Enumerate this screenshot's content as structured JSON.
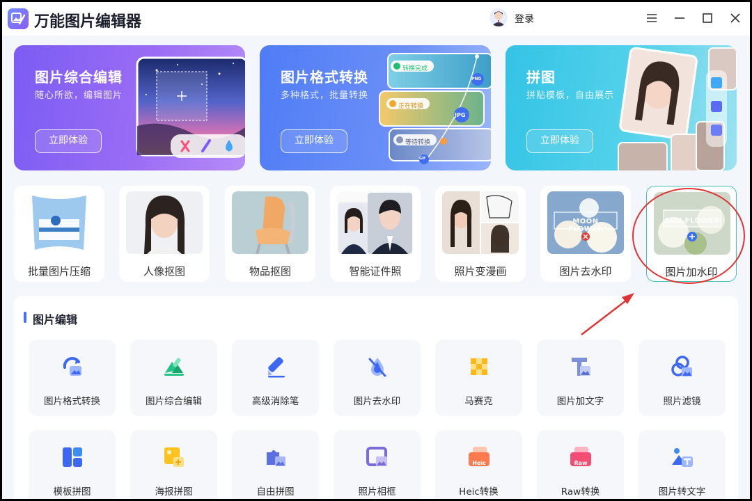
{
  "app": {
    "title": "万能图片编辑器",
    "login": "登录"
  },
  "banners": [
    {
      "title": "图片综合编辑",
      "subtitle": "随心所欲，编辑图片",
      "button": "立即体验"
    },
    {
      "title": "图片格式转换",
      "subtitle": "多种格式，批量转换",
      "button": "立即体验",
      "chips": [
        "转换完成",
        "正在转换",
        "等待转换"
      ],
      "formats": [
        "PNG",
        "JPG",
        "GIF"
      ]
    },
    {
      "title": "拼图",
      "subtitle": "拼贴模板，自由展示",
      "button": "立即体验"
    }
  ],
  "quick_tools": [
    {
      "label": "批量图片压缩"
    },
    {
      "label": "人像抠图"
    },
    {
      "label": "物品抠图"
    },
    {
      "label": "智能证件照"
    },
    {
      "label": "照片变漫画"
    },
    {
      "label": "图片去水印",
      "thumb_text": "MOON FLOWER"
    },
    {
      "label": "图片加水印",
      "thumb_text": "SUN FLOWER"
    }
  ],
  "section": {
    "title": "图片编辑",
    "items": [
      {
        "label": "图片格式转换",
        "icon": "format-convert-icon"
      },
      {
        "label": "图片综合编辑",
        "icon": "comprehensive-edit-icon"
      },
      {
        "label": "高级消除笔",
        "icon": "eraser-pen-icon"
      },
      {
        "label": "图片去水印",
        "icon": "remove-watermark-icon"
      },
      {
        "label": "马赛克",
        "icon": "mosaic-icon"
      },
      {
        "label": "图片加文字",
        "icon": "add-text-icon"
      },
      {
        "label": "照片滤镜",
        "icon": "filter-icon"
      },
      {
        "label": "模板拼图",
        "icon": "template-collage-icon"
      },
      {
        "label": "海报拼图",
        "icon": "poster-collage-icon"
      },
      {
        "label": "自由拼图",
        "icon": "free-collage-icon"
      },
      {
        "label": "照片相框",
        "icon": "photo-frame-icon"
      },
      {
        "label": "Heic转换",
        "icon": "heic-convert-icon",
        "badge": "Heic"
      },
      {
        "label": "Raw转换",
        "icon": "raw-convert-icon",
        "badge": "Raw"
      },
      {
        "label": "图片转文字",
        "icon": "image-to-text-icon"
      }
    ]
  },
  "colors": {
    "accent": "#4a6cf7",
    "highlight": "#e03434",
    "selected_border": "#48c2b7"
  }
}
